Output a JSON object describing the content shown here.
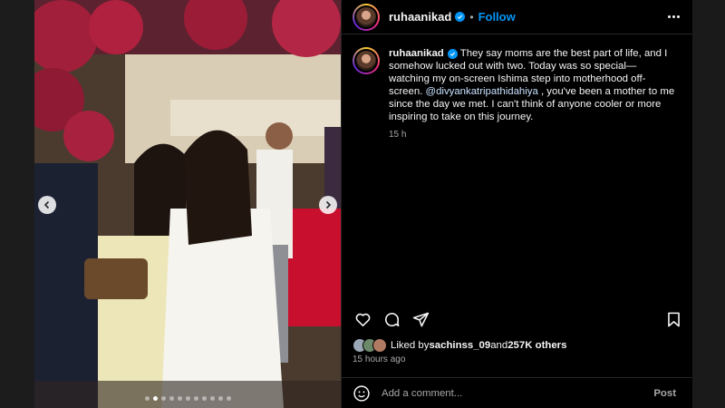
{
  "post": {
    "username": "ruhaanikad",
    "follow_label": "Follow",
    "separator": "•",
    "caption_pre": " They say moms are the best part of life, and I somehow lucked out with two. Today was so special—watching my on-screen Ishima step into motherhood off-screen. ",
    "mention": "@divyankatripathidahiya",
    "caption_post": " , you've been a mother to me since the day we met. I can't think of anyone cooler or more inspiring to take on this journey.",
    "caption_time": "15 h",
    "liked_by_prefix": "Liked by ",
    "liked_by_user": "sachinss_09",
    "liked_by_and": " and ",
    "liked_by_others": "257K others",
    "posted_ago": "15 hours ago",
    "comment_placeholder": "Add a comment...",
    "post_label": "Post"
  },
  "carousel": {
    "slide_count": 11,
    "active_index": 1
  },
  "icons": {
    "verified": "verified-badge-icon",
    "more": "more-options-icon",
    "like": "heart-icon",
    "comment": "comment-icon",
    "share": "share-icon",
    "save": "bookmark-icon",
    "emoji": "emoji-icon",
    "prev": "chevron-left-icon",
    "next": "chevron-right-icon"
  },
  "colors": {
    "accent": "#0095f6",
    "background": "#000000",
    "secondary_text": "#a8a8a8"
  }
}
